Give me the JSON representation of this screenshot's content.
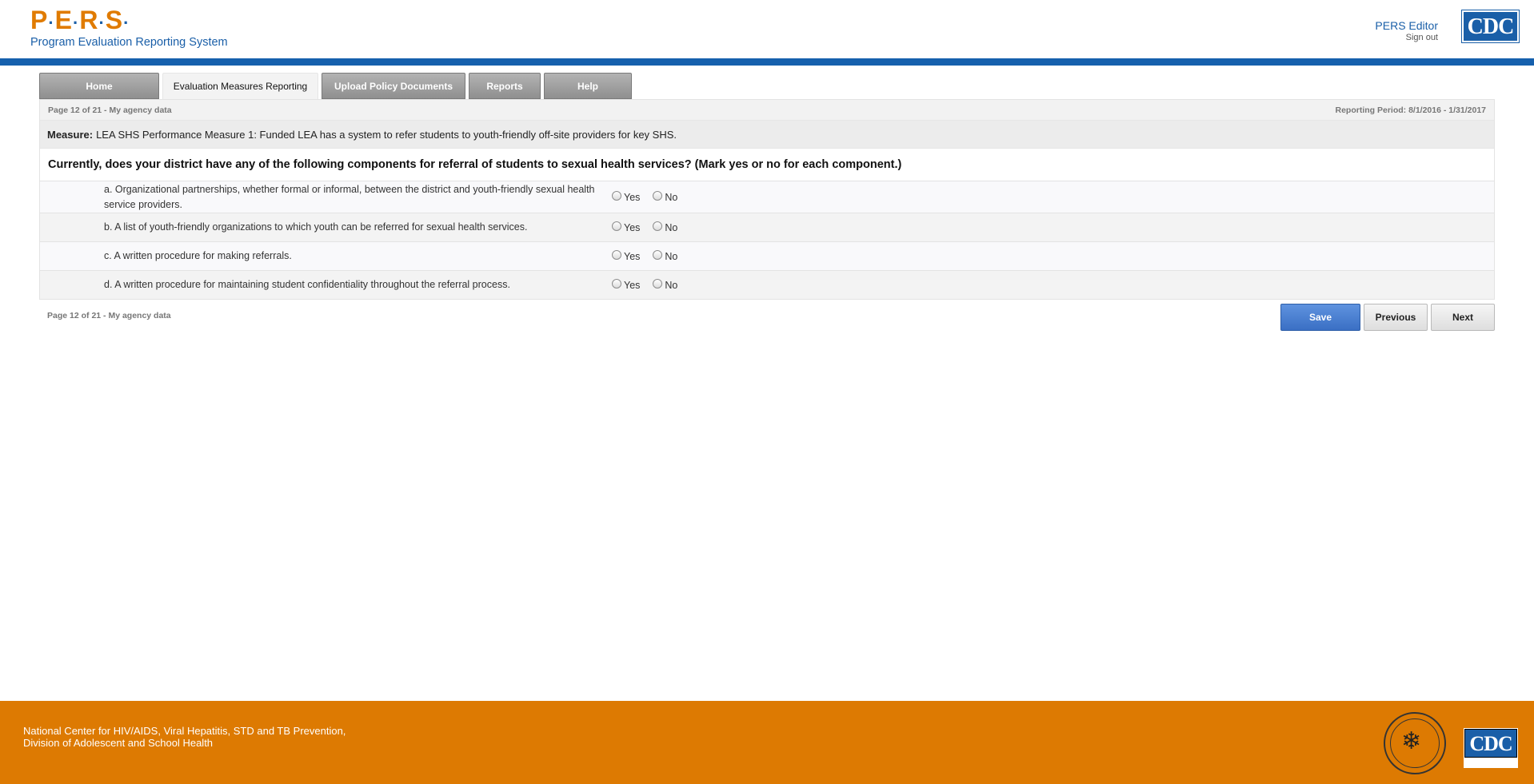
{
  "header": {
    "logo_text": "P·E·R·S·",
    "logo_letters": [
      "P",
      "E",
      "R",
      "S"
    ],
    "subtitle": "Program Evaluation Reporting System",
    "user_name": "PERS Editor",
    "sign_out": "Sign out",
    "cdc_logo": "CDC"
  },
  "tabs": [
    {
      "label": "Home",
      "active": false
    },
    {
      "label": "Evaluation Measures Reporting",
      "active": true
    },
    {
      "label": "Upload Policy Documents",
      "active": false
    },
    {
      "label": "Reports",
      "active": false
    },
    {
      "label": "Help",
      "active": false
    }
  ],
  "panel": {
    "page_info": "Page 12 of 21 - My agency data",
    "reporting_period": "Reporting Period: 8/1/2016 - 1/31/2017",
    "measure_label": "Measure:",
    "measure_text": "LEA SHS Performance Measure 1: Funded LEA has a system to refer students to youth-friendly off-site providers for key SHS.",
    "question": "Currently, does your district have any of the following components for referral of students to sexual health services? (Mark yes or no for each component.)",
    "items": [
      {
        "text": "a. Organizational partnerships, whether formal or informal, between the district and youth-friendly sexual health service providers.",
        "yes": "Yes",
        "no": "No"
      },
      {
        "text": "b. A list of youth-friendly organizations to which youth can be referred for sexual health services.",
        "yes": "Yes",
        "no": "No"
      },
      {
        "text": "c. A written procedure for making referrals.",
        "yes": "Yes",
        "no": "No"
      },
      {
        "text": "d. A written procedure for maintaining student confidentiality throughout the referral process.",
        "yes": "Yes",
        "no": "No"
      }
    ],
    "page_info_bottom": "Page 12 of 21 - My agency data"
  },
  "buttons": {
    "save": "Save",
    "previous": "Previous",
    "next": "Next"
  },
  "footer": {
    "line1": "National Center for HIV/AIDS, Viral Hepatitis, STD and TB Prevention,",
    "line2": "Division of Adolescent and School Health",
    "cdc_logo": "CDC"
  },
  "colors": {
    "brand_orange": "#dd7a02",
    "brand_blue": "#1660ad",
    "save_blue": "#3a6fc4"
  }
}
